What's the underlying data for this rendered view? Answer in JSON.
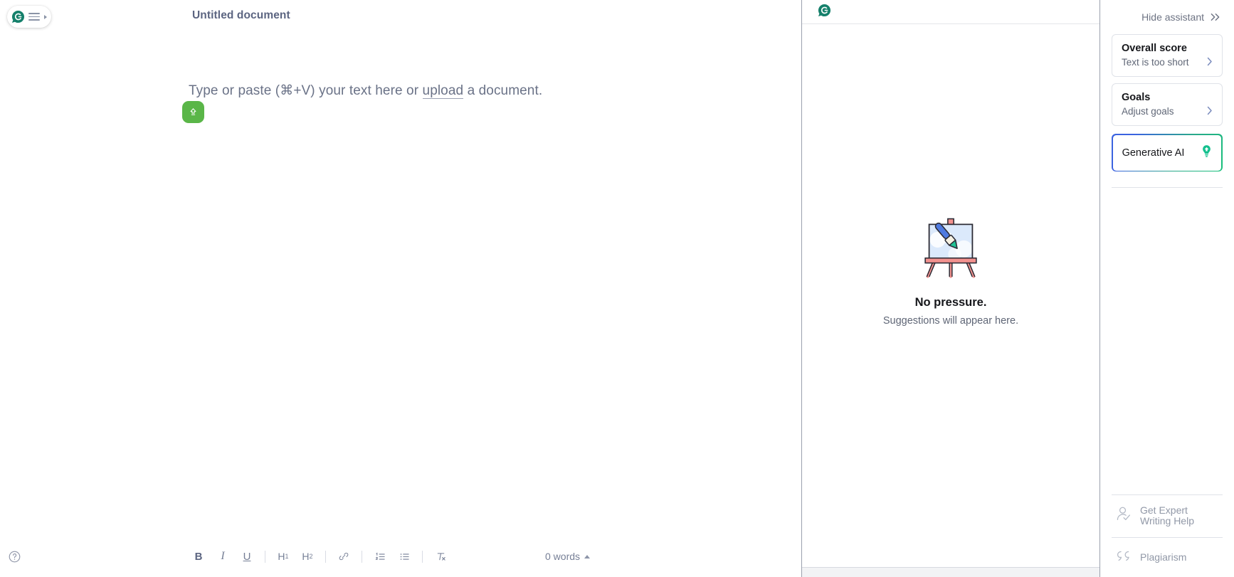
{
  "brand": {
    "logo_icon": "grammarly-g-logo",
    "menu_icon": "hamburger-menu-icon",
    "expand_icon": "caret-right-icon"
  },
  "editor": {
    "document_title": "Untitled document",
    "placeholder_prefix": "Type or paste (⌘+V) your text here or ",
    "placeholder_link": "upload",
    "placeholder_suffix": " a document.",
    "upload_badge_icon": "upload-arrow-icon",
    "help_icon": "question-mark-circle-icon"
  },
  "toolbar": {
    "bold_label": "B",
    "italic_label": "I",
    "underline_label": "U",
    "h1_label": "H",
    "h1_sub": "1",
    "h2_label": "H",
    "h2_sub": "2",
    "link_icon": "link-icon",
    "ordered_list_icon": "numbered-list-icon",
    "bullet_list_icon": "bullet-list-icon",
    "clear_format_icon": "clear-formatting-icon",
    "word_count": "0 words",
    "word_count_caret_icon": "caret-up-icon"
  },
  "suggestions": {
    "logo_icon": "grammarly-g-logo",
    "illustration_icon": "easel-paintbrush-illustration",
    "empty_title": "No pressure.",
    "empty_subtitle": "Suggestions will appear here."
  },
  "assistant": {
    "hide_label": "Hide assistant",
    "hide_icon": "double-chevron-right-icon",
    "cards": [
      {
        "title": "Overall score",
        "subtitle": "Text is too short",
        "chevron_icon": "chevron-right-icon"
      },
      {
        "title": "Goals",
        "subtitle": "Adjust goals",
        "chevron_icon": "chevron-right-icon"
      }
    ],
    "generative_ai": {
      "label": "Generative AI",
      "icon": "lightbulb-icon"
    },
    "bottom_links": [
      {
        "label_line1": "Get Expert",
        "label_line2": "Writing Help",
        "icon": "person-check-icon"
      },
      {
        "label_line1": "Plagiarism",
        "label_line2": "",
        "icon": "quotation-marks-icon"
      }
    ]
  },
  "colors": {
    "brand_green": "#15806b",
    "upload_green": "#5ab648",
    "accent_blue": "#3b63e0",
    "accent_teal": "#16c07a",
    "title_text": "#5c6581",
    "muted_text": "#6a7287"
  }
}
